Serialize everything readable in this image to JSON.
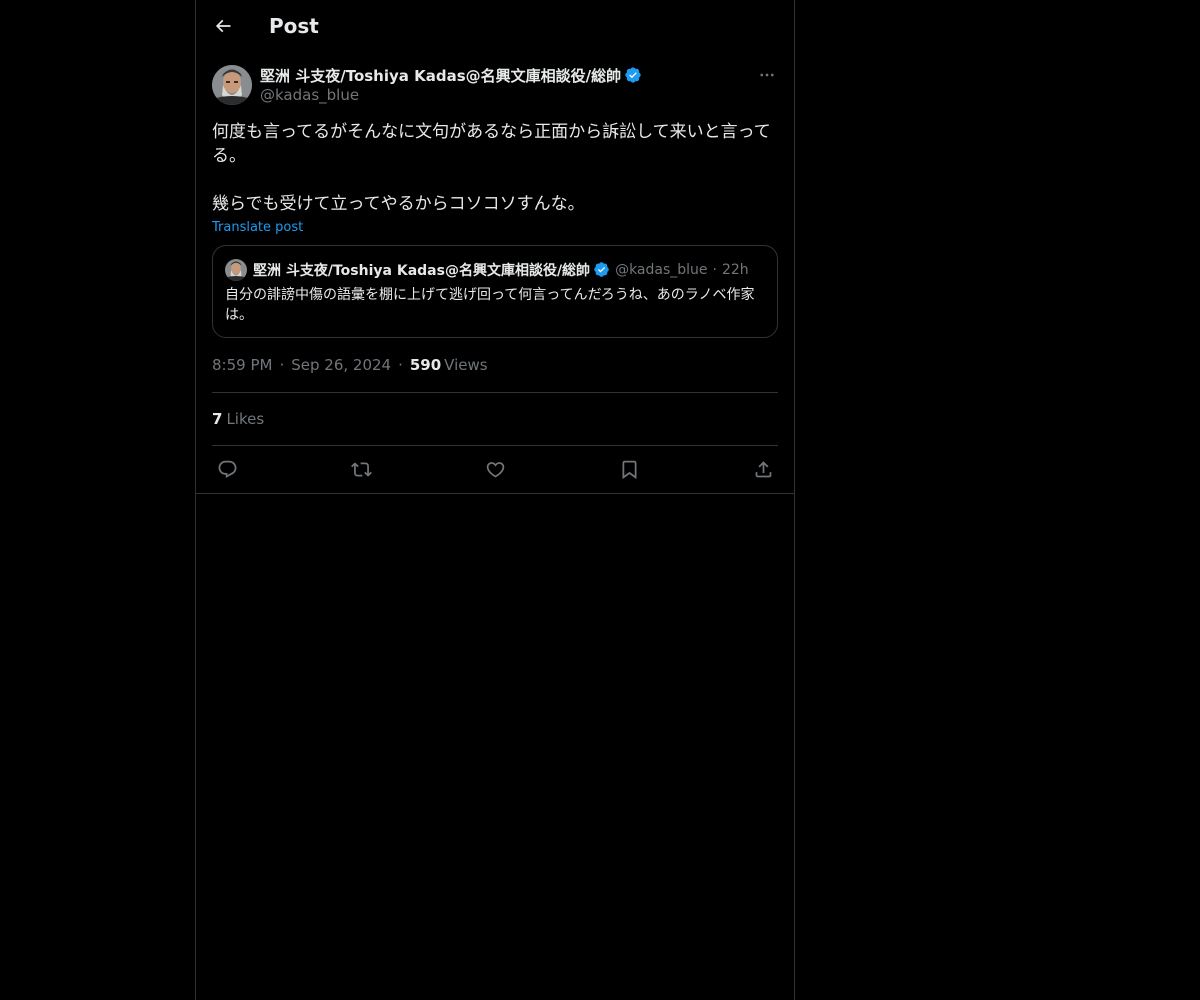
{
  "header": {
    "title": "Post",
    "back_icon": "arrow-left-icon"
  },
  "post": {
    "author": {
      "display_name": "堅洲 斗支夜/Toshiya Kadas@名興文庫相談役/総帥",
      "handle": "@kadas_blue",
      "verified": true
    },
    "text": "何度も言ってるがそんなに文句があるなら正面から訴訟して来いと言ってる。\n\n幾らでも受けて立ってやるからコソコソすんな。",
    "translate_label": "Translate post",
    "quote": {
      "author_name": "堅洲 斗支夜/Toshiya Kadas@名興文庫相談役/総帥",
      "handle": "@kadas_blue",
      "separator": "·",
      "time": "22h",
      "text": "自分の誹謗中傷の語彙を棚に上げて逃げ回って何言ってんだろうね、あのラノベ作家は。"
    },
    "meta": {
      "time": "8:59 PM",
      "separator": "·",
      "date": "Sep 26, 2024",
      "views_count": "590",
      "views_label": "Views"
    },
    "likes": {
      "count": "7",
      "label": "Likes"
    },
    "actions": [
      "reply-icon",
      "repost-icon",
      "like-icon",
      "bookmark-icon",
      "share-icon"
    ]
  },
  "colors": {
    "background": "#000000",
    "text": "#e7e9ea",
    "secondary_text": "#71767b",
    "accent": "#1d9bf0",
    "border": "#2f3336"
  }
}
